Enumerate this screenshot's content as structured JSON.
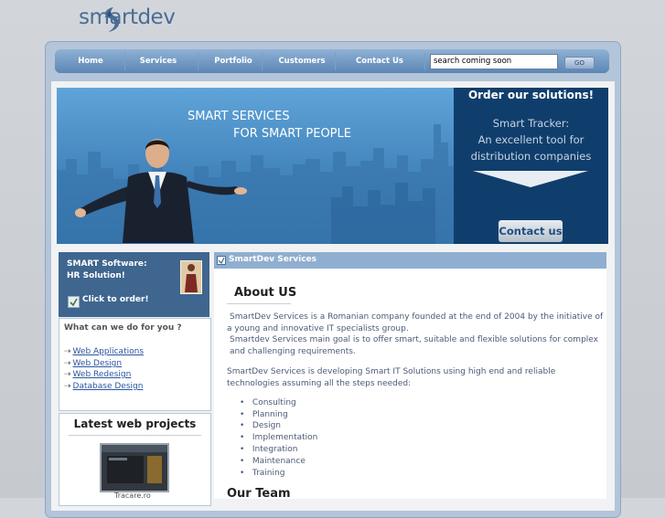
{
  "logo": {
    "text": "smartdev"
  },
  "nav": {
    "items": [
      "Home",
      "Services",
      "Portfolio",
      "Customers",
      "Contact Us"
    ],
    "search_value": "search coming soon",
    "go_label": "GO"
  },
  "banner": {
    "line1": "SMART SERVICES",
    "line2": "FOR SMART PEOPLE",
    "order_title": "Order our solutions!",
    "tracker_lines": [
      "Smart Tracker:",
      "An excellent tool for",
      "distribution companies"
    ],
    "contact_label": "Contact us"
  },
  "sidebar": {
    "promo_line1": "SMART Software:",
    "promo_line2": "HR Solution!",
    "order_link": "Click to order!",
    "what_title": "What can we do for you ?",
    "services": [
      "Web Applications",
      "Web Design",
      "Web Redesign",
      "Database Design"
    ],
    "latest_title": "Latest web projects",
    "latest_caption": "Tracare.ro"
  },
  "content": {
    "header": "SmartDev Services",
    "about_title": "About US",
    "para1": "SmartDev Services is a Romanian company founded at the end of 2004 by the initiative of a young and innovative IT specialists group.",
    "para2": "Smartdev Services main goal is to offer smart, suitable and flexible solutions for complex and challenging requirements.",
    "para3": "SmartDev Services is developing Smart IT Solutions using high end and reliable technologies assuming all the steps needed:",
    "steps": [
      "Consulting",
      "Planning",
      "Design",
      "Implementation",
      "Integration",
      "Maintenance",
      "Training"
    ],
    "team_title": "Our Team"
  }
}
